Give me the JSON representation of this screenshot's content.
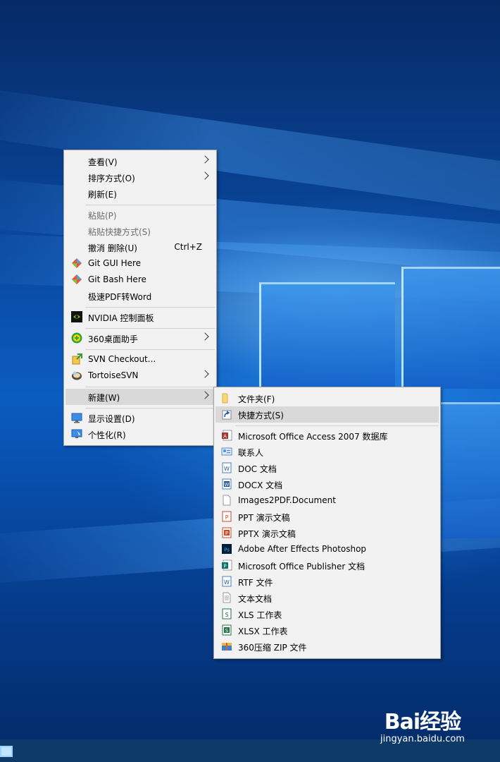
{
  "context_menu": {
    "items": [
      {
        "label": "查看(V)",
        "arrow": true
      },
      {
        "label": "排序方式(O)",
        "arrow": true
      },
      {
        "label": "刷新(E)"
      },
      {
        "label": "粘贴(P)",
        "disabled": true
      },
      {
        "label": "粘贴快捷方式(S)",
        "disabled": true
      },
      {
        "label": "撤消 删除(U)",
        "shortcut": "Ctrl+Z"
      },
      {
        "label": "Git GUI Here",
        "icon": "git-gui-icon"
      },
      {
        "label": "Git Bash Here",
        "icon": "git-bash-icon"
      },
      {
        "label": "极速PDF转Word"
      },
      {
        "label": "NVIDIA 控制面板",
        "icon": "nvidia-icon"
      },
      {
        "label": "360桌面助手",
        "icon": "360-desktop-icon",
        "arrow": true
      },
      {
        "label": "SVN Checkout...",
        "icon": "svn-checkout-icon"
      },
      {
        "label": "TortoiseSVN",
        "icon": "tortoise-svn-icon",
        "arrow": true
      },
      {
        "label": "新建(W)",
        "arrow": true,
        "highlighted": true
      },
      {
        "label": "显示设置(D)",
        "icon": "display-settings-icon"
      },
      {
        "label": "个性化(R)",
        "icon": "personalize-icon"
      }
    ]
  },
  "new_submenu": {
    "items": [
      {
        "label": "文件夹(F)",
        "icon": "folder-icon"
      },
      {
        "label": "快捷方式(S)",
        "icon": "shortcut-icon",
        "highlighted": true
      },
      {
        "label": "Microsoft Office Access 2007 数据库",
        "icon": "access-icon"
      },
      {
        "label": "联系人",
        "icon": "contact-icon"
      },
      {
        "label": "DOC 文档",
        "icon": "doc-icon"
      },
      {
        "label": "DOCX 文档",
        "icon": "docx-icon"
      },
      {
        "label": "Images2PDF.Document",
        "icon": "blank-file-icon"
      },
      {
        "label": "PPT 演示文稿",
        "icon": "ppt-icon"
      },
      {
        "label": "PPTX 演示文稿",
        "icon": "pptx-icon"
      },
      {
        "label": "Adobe After Effects Photoshop",
        "icon": "photoshop-icon"
      },
      {
        "label": "Microsoft Office Publisher 文档",
        "icon": "publisher-icon"
      },
      {
        "label": "RTF 文件",
        "icon": "rtf-icon"
      },
      {
        "label": "文本文档",
        "icon": "text-file-icon"
      },
      {
        "label": "XLS 工作表",
        "icon": "xls-icon"
      },
      {
        "label": "XLSX 工作表",
        "icon": "xlsx-icon"
      },
      {
        "label": "360压缩 ZIP 文件",
        "icon": "zip-icon"
      }
    ]
  },
  "watermark": {
    "logo": "Bai经验",
    "url": "jingyan.baidu.com"
  },
  "colors": {
    "menu_bg": "#f2f2f2",
    "highlight": "#d9d9d9",
    "disabled_text": "#6d6d6d",
    "desktop_blue": "#0b5cc0"
  }
}
